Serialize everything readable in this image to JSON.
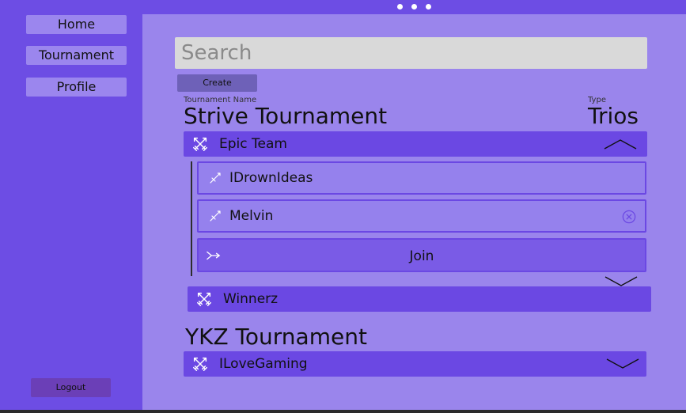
{
  "window": {
    "dots": 3
  },
  "sidebar": {
    "items": [
      {
        "label": "Home"
      },
      {
        "label": "Tournament"
      },
      {
        "label": "Profile"
      }
    ],
    "logout_label": "Logout"
  },
  "main": {
    "search_placeholder": "Search",
    "create_label": "Create",
    "tournament_name_label": "Tournament Name",
    "type_label": "Type",
    "tournaments": [
      {
        "name": "Strive Tournament",
        "type": "Trios",
        "teams": [
          {
            "name": "Epic Team",
            "expanded": true,
            "members": [
              {
                "name": "IDrownIdeas"
              },
              {
                "name": "Melvin"
              }
            ],
            "join_label": "Join"
          },
          {
            "name": "Winnerz",
            "expanded": false
          }
        ]
      },
      {
        "name": "YKZ Tournament",
        "teams": [
          {
            "name": "ILoveGaming",
            "expanded": false
          }
        ]
      }
    ]
  },
  "colors": {
    "sidebar_bg": "#6d4de4",
    "main_bg": "#9a85ec",
    "team_bar": "#6b48e3",
    "nav_button": "#9b86ee",
    "logout_button": "#6b3fb7",
    "search_bg": "#d9d9d9"
  }
}
